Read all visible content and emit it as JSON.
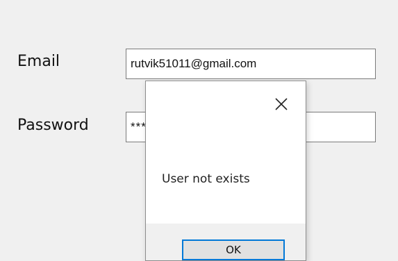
{
  "form": {
    "email_label": "Email",
    "email_value": "rutvik51011@gmail.com",
    "password_label": "Password",
    "password_value": "***"
  },
  "dialog": {
    "message": "User not exists",
    "ok_label": "OK",
    "close_icon": "close-icon"
  },
  "colors": {
    "background": "#f0f0f0",
    "focus_accent": "#0078d7"
  }
}
